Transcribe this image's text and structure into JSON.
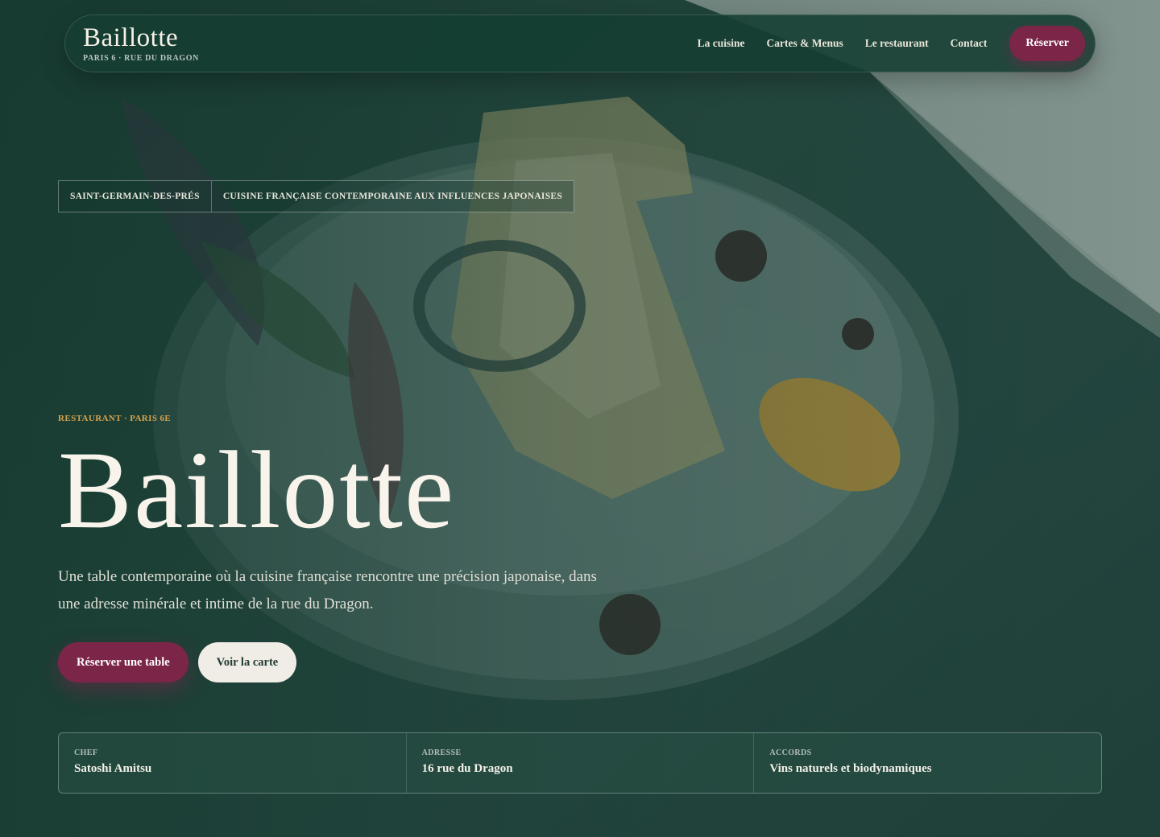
{
  "colors": {
    "brand_green": "#1d3f36",
    "accent_burgundy": "#7b2648",
    "eyebrow_gold": "#d6a24d",
    "light_button": "#efede6"
  },
  "header": {
    "brand_name": "Baillotte",
    "brand_sub": "PARIS 6 · RUE DU DRAGON",
    "nav": [
      {
        "label": "La cuisine"
      },
      {
        "label": "Cartes & Menus"
      },
      {
        "label": "Le restaurant"
      },
      {
        "label": "Contact"
      }
    ],
    "cta_label": "Réserver"
  },
  "tags": [
    {
      "label": "SAINT-GERMAIN-DES-PRÉS"
    },
    {
      "label": "CUISINE FRANÇAISE CONTEMPORAINE AUX INFLUENCES JAPONAISES"
    }
  ],
  "hero": {
    "eyebrow": "RESTAURANT · PARIS 6E",
    "title": "Baillotte",
    "description": "Une table contemporaine où la cuisine française rencontre une précision japonaise, dans une adresse minérale et intime de la rue du Dragon.",
    "primary_button": "Réserver une table",
    "secondary_button": "Voir la carte"
  },
  "info": [
    {
      "label": "CHEF",
      "value": "Satoshi Amitsu"
    },
    {
      "label": "ADRESSE",
      "value": "16 rue du Dragon"
    },
    {
      "label": "ACCORDS",
      "value": "Vins naturels et biodynamiques"
    }
  ]
}
